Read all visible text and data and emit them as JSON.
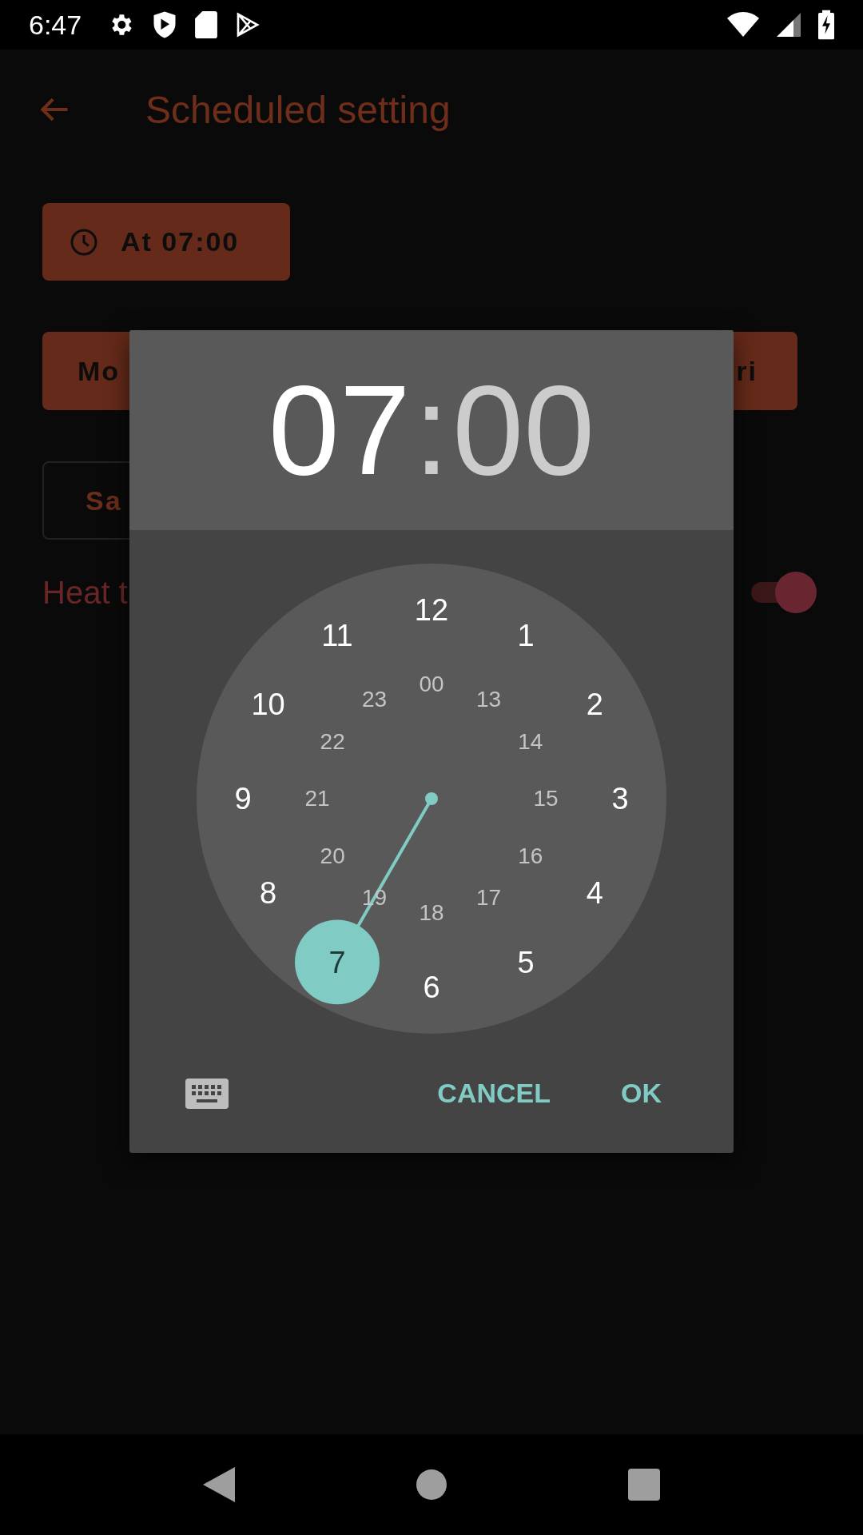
{
  "status_bar": {
    "time": "6:47"
  },
  "app_bar": {
    "title": "Scheduled setting"
  },
  "schedule": {
    "time_button": "At 07:00",
    "weekdays_button": {
      "left_text": "Mo",
      "right_text": "ri"
    },
    "weekend_button": {
      "text": "Sa"
    },
    "heat_label": "Heat t",
    "heat_switch": {
      "on": true
    }
  },
  "time_picker": {
    "hour": {
      "text": "07",
      "selected": true
    },
    "separator": ":",
    "minute": {
      "text": "00",
      "selected": false
    },
    "outer_numbers": [
      {
        "label": "12",
        "selected": false
      },
      {
        "label": "1",
        "selected": false
      },
      {
        "label": "2",
        "selected": false
      },
      {
        "label": "3",
        "selected": false
      },
      {
        "label": "4",
        "selected": false
      },
      {
        "label": "5",
        "selected": false
      },
      {
        "label": "6",
        "selected": false
      },
      {
        "label": "7",
        "selected": true
      },
      {
        "label": "8",
        "selected": false
      },
      {
        "label": "9",
        "selected": false
      },
      {
        "label": "10",
        "selected": false
      },
      {
        "label": "11",
        "selected": false
      }
    ],
    "inner_numbers": [
      {
        "label": "00",
        "selected": false
      },
      {
        "label": "13",
        "selected": false
      },
      {
        "label": "14",
        "selected": false
      },
      {
        "label": "15",
        "selected": false
      },
      {
        "label": "16",
        "selected": false
      },
      {
        "label": "17",
        "selected": false
      },
      {
        "label": "18",
        "selected": false
      },
      {
        "label": "19",
        "selected": false
      },
      {
        "label": "20",
        "selected": false
      },
      {
        "label": "21",
        "selected": false
      },
      {
        "label": "22",
        "selected": false
      },
      {
        "label": "23",
        "selected": false
      }
    ],
    "buttons": [
      "CANCEL",
      "OK"
    ]
  }
}
